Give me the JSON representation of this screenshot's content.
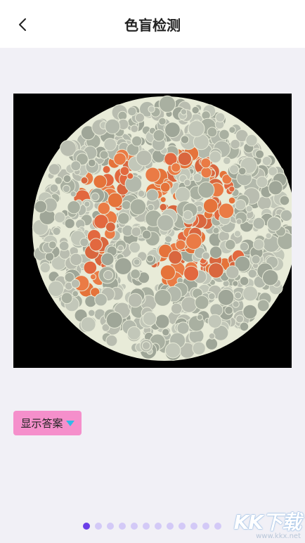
{
  "header": {
    "title": "色盲检测",
    "back_icon": "chevron-left-icon"
  },
  "plate": {
    "number_shown": "12",
    "dot_palette": [
      "#b7bdb0",
      "#aab2a2",
      "#c6cbbd",
      "#e46b43",
      "#e2762f"
    ],
    "background": "#000000"
  },
  "answer_button": {
    "label": "显示答案",
    "icon": "caret-down-icon",
    "bg_color": "#f58fcb",
    "icon_color": "#2fb9e8"
  },
  "pagination": {
    "total": 12,
    "active_index": 0
  },
  "watermark": {
    "logo": "KK下载",
    "url": "www.kkx.net"
  }
}
